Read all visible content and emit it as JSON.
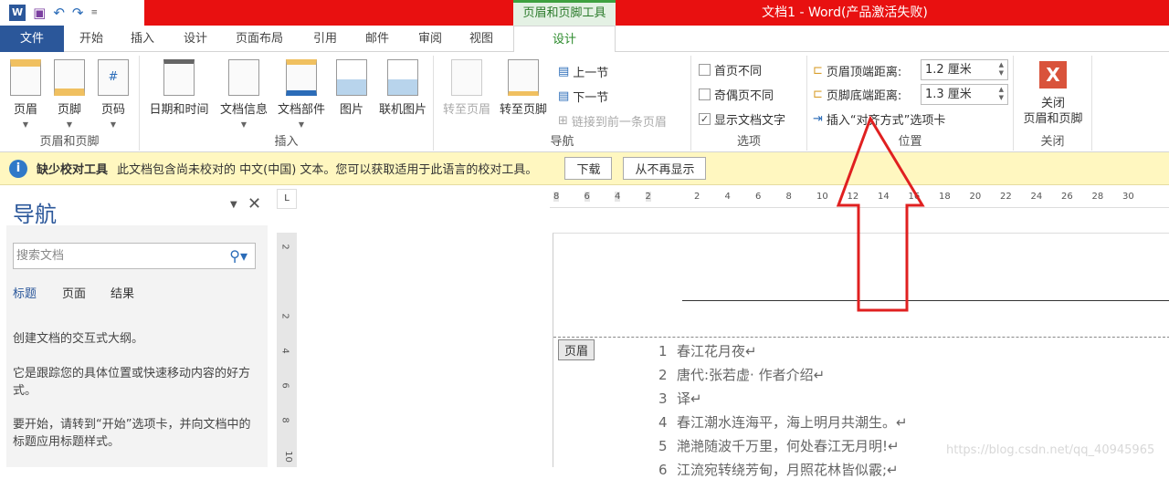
{
  "title_bar": {
    "window_title": "文档1 -  Word(产品激活失败)",
    "context_tab_group": "页眉和页脚工具",
    "qat": [
      "word-logo-icon",
      "save-icon",
      "undo-icon",
      "redo-icon",
      "customize-icon"
    ]
  },
  "tabs": [
    "文件",
    "开始",
    "插入",
    "设计",
    "页面布局",
    "引用",
    "邮件",
    "审阅",
    "视图",
    "设计"
  ],
  "ribbon": {
    "header_footer": {
      "label": "页眉和页脚",
      "buttons": [
        "页眉",
        "页脚",
        "页码"
      ]
    },
    "insert": {
      "label": "插入",
      "buttons": [
        "日期和时间",
        "文档信息",
        "文档部件",
        "图片",
        "联机图片"
      ]
    },
    "navigation": {
      "label": "导航",
      "buttons": [
        "转至页眉",
        "转至页脚"
      ],
      "prev": "上一节",
      "next": "下一节",
      "link": "链接到前一条页眉"
    },
    "options": {
      "label": "选项",
      "items": [
        {
          "label": "首页不同",
          "checked": false
        },
        {
          "label": "奇偶页不同",
          "checked": false
        },
        {
          "label": "显示文档文字",
          "checked": true
        }
      ]
    },
    "position": {
      "label": "位置",
      "header_top_label": "页眉顶端距离:",
      "header_top_value": "1.2 厘米",
      "footer_bottom_label": "页脚底端距离:",
      "footer_bottom_value": "1.3 厘米",
      "insert_align": "插入“对齐方式”选项卡"
    },
    "close": {
      "label": "关闭",
      "button_line1": "关闭",
      "button_line2": "页眉和页脚"
    }
  },
  "infobar": {
    "title": "缺少校对工具",
    "message": "此文档包含尚未校对的 中文(中国) 文本。您可以获取适用于此语言的校对工具。",
    "download": "下载",
    "dismiss": "从不再显示"
  },
  "nav_pane": {
    "title": "导航",
    "search_placeholder": "搜索文档",
    "tabs": [
      "标题",
      "页面",
      "结果"
    ],
    "text1": "创建文档的交互式大纲。",
    "text2": "它是跟踪您的具体位置或快速移动内容的好方式。",
    "text3": "要开始，请转到“开始”选项卡，并向文档中的标题应用标题样式。"
  },
  "ruler": {
    "h_ticks": [
      "8",
      "6",
      "4",
      "2",
      "2",
      "4",
      "6",
      "8",
      "10",
      "12",
      "14",
      "16",
      "18",
      "20",
      "22",
      "24",
      "26",
      "28",
      "30"
    ],
    "v_ticks": [
      "2",
      "2",
      "4",
      "6",
      "8",
      "10"
    ]
  },
  "document": {
    "header_tag": "页眉",
    "lines": [
      {
        "n": "1",
        "t": "春江花月夜↵"
      },
      {
        "n": "2",
        "t": "唐代:张若虚· 作者介绍↵"
      },
      {
        "n": "3",
        "t": "译↵"
      },
      {
        "n": "4",
        "t": "春江潮水连海平，海上明月共潮生。↵"
      },
      {
        "n": "5",
        "t": "滟滟随波千万里，何处春江无月明!↵"
      },
      {
        "n": "6",
        "t": "江流宛转绕芳甸，月照花林皆似霰;↵"
      }
    ],
    "watermark": "https://blog.csdn.net/qq_40945965"
  },
  "colors": {
    "title_red": "#e81010",
    "file_blue": "#2b579a",
    "context_green": "#2a8a2a",
    "arrow_red": "#e02020"
  }
}
